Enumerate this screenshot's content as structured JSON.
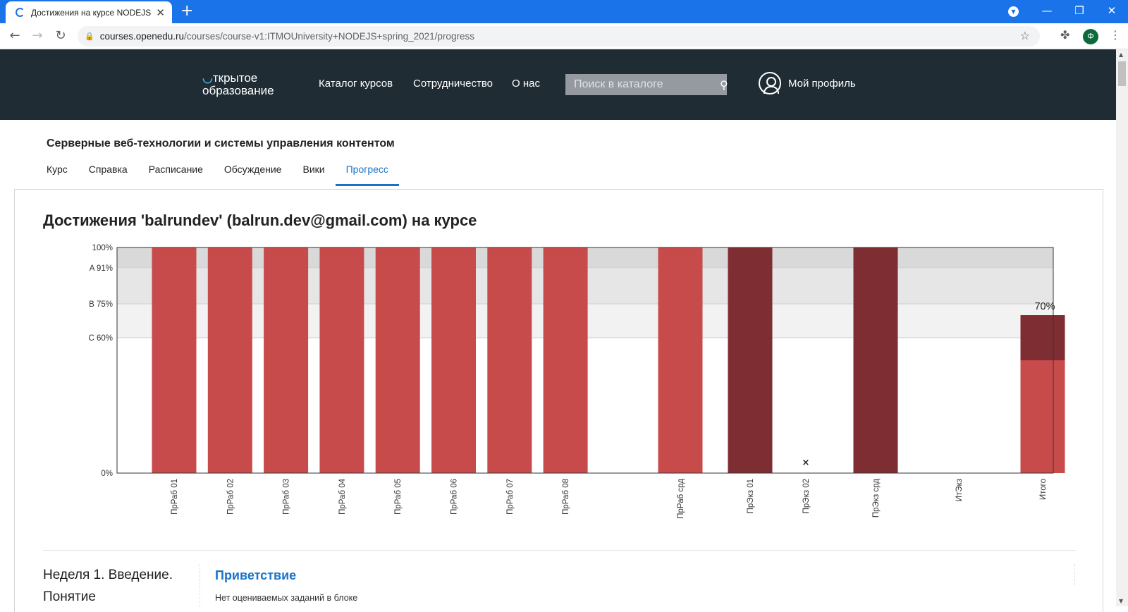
{
  "browser": {
    "tab_title": "Достижения на курсе NODEJS |",
    "url_host": "courses.openedu.ru",
    "url_path": "/courses/course-v1:ITMOUniversity+NODEJS+spring_2021/progress",
    "profile_initial": "Ф"
  },
  "site": {
    "logo_line1": "ткрытое",
    "logo_line2": "образование",
    "nav": [
      "Каталог курсов",
      "Сотрудничество",
      "О нас"
    ],
    "search_placeholder": "Поиск в каталоге",
    "profile_label": "Мой профиль"
  },
  "course": {
    "title": "Серверные веб-технологии и системы управления контентом",
    "tabs": [
      "Курс",
      "Справка",
      "Расписание",
      "Обсуждение",
      "Вики",
      "Прогресс"
    ],
    "active_tab": "Прогресс"
  },
  "page_title": "Достижения 'balrundev' (balrun.dev@gmail.com) на курсе",
  "chart_data": {
    "type": "bar",
    "categories": [
      "ПрРаб 01",
      "ПрРаб 02",
      "ПрРаб 03",
      "ПрРаб 04",
      "ПрРаб 05",
      "ПрРаб 06",
      "ПрРаб 07",
      "ПрРаб 08",
      "ПрРаб срд",
      "ПрЭкз 01",
      "ПрЭкз 02",
      "ПрЭкз срд",
      "ИтЭкз",
      "Итого"
    ],
    "values": [
      100,
      100,
      100,
      100,
      100,
      100,
      100,
      100,
      100,
      100,
      0,
      100,
      0,
      70
    ],
    "bar_kind": [
      "work",
      "work",
      "work",
      "work",
      "work",
      "work",
      "work",
      "work",
      "work",
      "exam",
      "dropped",
      "exam",
      "none",
      "total"
    ],
    "total_segments": [
      50,
      20
    ],
    "total_label": "70%",
    "dropped_marker": "×",
    "grade_cutoffs": [
      {
        "label": "100%",
        "value": 100
      },
      {
        "label": "A 91%",
        "value": 91
      },
      {
        "label": "B 75%",
        "value": 75
      },
      {
        "label": "C 60%",
        "value": 60
      },
      {
        "label": "0%",
        "value": 0
      }
    ],
    "ylim": [
      0,
      100
    ],
    "colors": {
      "work": "#c84b4b",
      "exam": "#7e2e32",
      "band_a": "#d9d9d9",
      "band_b": "#e6e6e6",
      "band_c": "#f2f2f2"
    }
  },
  "progress_section": {
    "week_title": "Неделя 1. Введение. Понятие",
    "section_title": "Приветствие",
    "section_note": "Нет оцениваемых заданий в блоке"
  }
}
